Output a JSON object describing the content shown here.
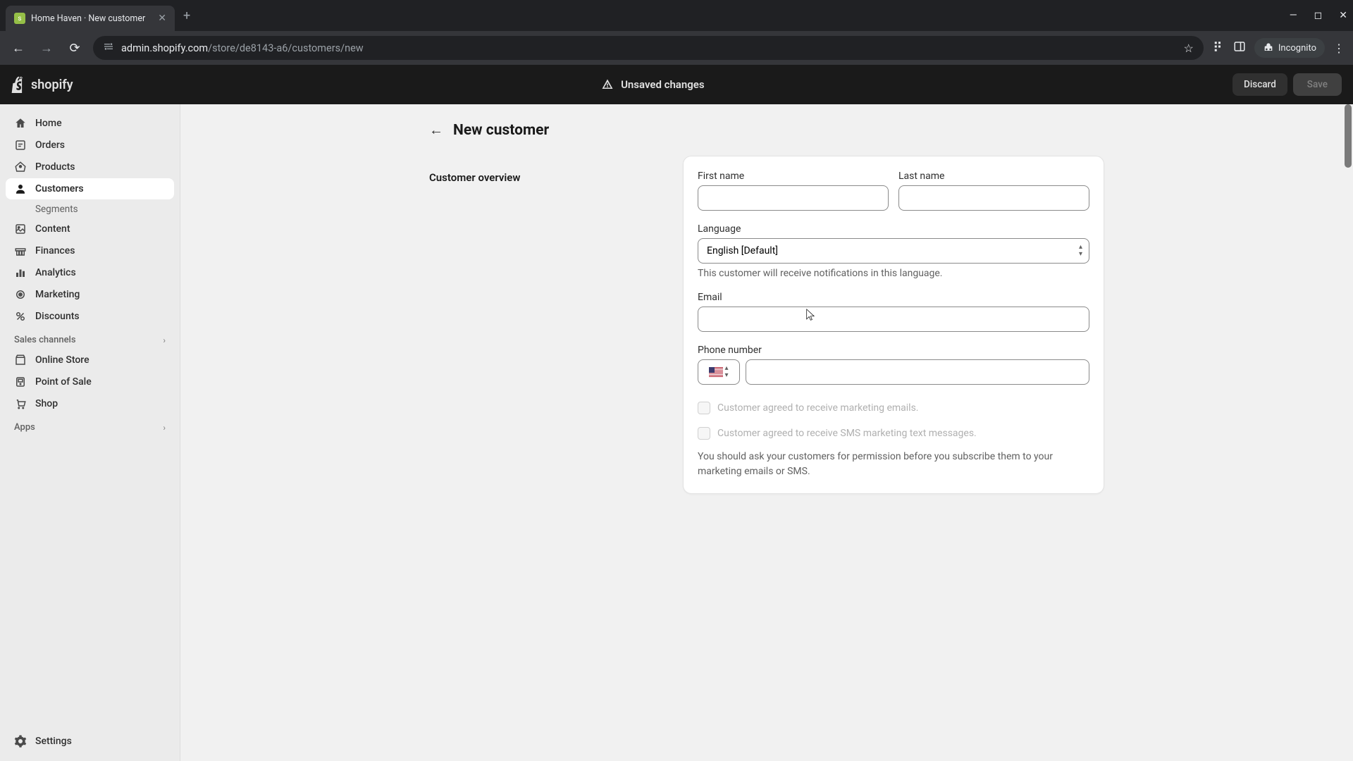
{
  "browser": {
    "tab_title": "Home Haven · New customer",
    "url_host": "admin.shopify.com",
    "url_path": "/store/de8143-a6/customers/new",
    "incognito_label": "Incognito"
  },
  "header": {
    "unsaved_text": "Unsaved changes",
    "discard_label": "Discard",
    "save_label": "Save",
    "logo_text": "shopify"
  },
  "sidebar": {
    "items": [
      {
        "label": "Home"
      },
      {
        "label": "Orders"
      },
      {
        "label": "Products"
      },
      {
        "label": "Customers"
      },
      {
        "label": "Content"
      },
      {
        "label": "Finances"
      },
      {
        "label": "Analytics"
      },
      {
        "label": "Marketing"
      },
      {
        "label": "Discounts"
      }
    ],
    "customers_sub": "Segments",
    "sales_channels_label": "Sales channels",
    "channels": [
      {
        "label": "Online Store"
      },
      {
        "label": "Point of Sale"
      },
      {
        "label": "Shop"
      }
    ],
    "apps_label": "Apps",
    "settings_label": "Settings"
  },
  "page": {
    "title": "New customer",
    "section_overview": "Customer overview",
    "labels": {
      "first_name": "First name",
      "last_name": "Last name",
      "language": "Language",
      "language_value": "English [Default]",
      "language_help": "This customer will receive notifications in this language.",
      "email": "Email",
      "phone": "Phone number",
      "marketing_email": "Customer agreed to receive marketing emails.",
      "marketing_sms": "Customer agreed to receive SMS marketing text messages.",
      "disclaimer": "You should ask your customers for permission before you subscribe them to your marketing emails or SMS."
    }
  }
}
